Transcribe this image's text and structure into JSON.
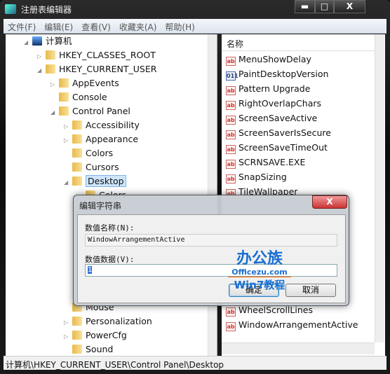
{
  "window": {
    "title": "注册表编辑器",
    "minimize": "▬",
    "maximize": "□",
    "close": "X"
  },
  "menu": [
    "文件(F)",
    "编辑(E)",
    "查看(V)",
    "收藏夹(A)",
    "帮助(H)"
  ],
  "tree": [
    {
      "label": "计算机",
      "level": 0,
      "exp": "◢"
    },
    {
      "label": "HKEY_CLASSES_ROOT",
      "level": 1,
      "exp": "▷"
    },
    {
      "label": "HKEY_CURRENT_USER",
      "level": 1,
      "exp": "◢"
    },
    {
      "label": "AppEvents",
      "level": 2,
      "exp": "▷"
    },
    {
      "label": "Console",
      "level": 2,
      "exp": ""
    },
    {
      "label": "Control Panel",
      "level": 2,
      "exp": "◢"
    },
    {
      "label": "Accessibility",
      "level": 3,
      "exp": "▷"
    },
    {
      "label": "Appearance",
      "level": 3,
      "exp": "▷"
    },
    {
      "label": "Colors",
      "level": 3,
      "exp": ""
    },
    {
      "label": "Cursors",
      "level": 3,
      "exp": ""
    },
    {
      "label": "Desktop",
      "level": 3,
      "exp": "◢",
      "selected": true
    },
    {
      "label": "Colors",
      "level": 4,
      "exp": ""
    },
    {
      "label": "",
      "level": 3,
      "exp": ""
    },
    {
      "label": "",
      "level": 3,
      "exp": ""
    },
    {
      "label": "",
      "level": 3,
      "exp": ""
    },
    {
      "label": "",
      "level": 3,
      "exp": ""
    },
    {
      "label": "",
      "level": 3,
      "exp": ""
    },
    {
      "label": "",
      "level": 3,
      "exp": ""
    },
    {
      "label": "",
      "level": 3,
      "exp": ""
    },
    {
      "label": "Mouse",
      "level": 3,
      "exp": ""
    },
    {
      "label": "Personalization",
      "level": 3,
      "exp": "▷"
    },
    {
      "label": "PowerCfg",
      "level": 3,
      "exp": "▷"
    },
    {
      "label": "Sound",
      "level": 3,
      "exp": ""
    }
  ],
  "list": {
    "header": "名称",
    "items": [
      {
        "name": "MenuShowDelay",
        "type": "ab"
      },
      {
        "name": "PaintDesktopVersion",
        "type": "bin"
      },
      {
        "name": "Pattern Upgrade",
        "type": "ab"
      },
      {
        "name": "RightOverlapChars",
        "type": "ab"
      },
      {
        "name": "ScreenSaveActive",
        "type": "ab"
      },
      {
        "name": "ScreenSaverIsSecure",
        "type": "ab"
      },
      {
        "name": "ScreenSaveTimeOut",
        "type": "ab"
      },
      {
        "name": "SCRNSAVE.EXE",
        "type": "ab"
      },
      {
        "name": "SnapSizing",
        "type": "ab"
      },
      {
        "name": "TileWallpaper",
        "type": "ab"
      }
    ],
    "bottom_items": [
      {
        "name": "WheelScrollLines",
        "type": "ab"
      },
      {
        "name": "WindowArrangementActive",
        "type": "ab"
      }
    ]
  },
  "status": "计算机\\HKEY_CURRENT_USER\\Control Panel\\Desktop",
  "dialog": {
    "title": "编辑字符串",
    "close": "X",
    "name_label": "数值名称(N):",
    "name_value": "WindowArrangementActive",
    "data_label": "数值数据(V):",
    "data_value": "1",
    "ok": "确定",
    "cancel": "取消"
  },
  "watermark": {
    "line1": "办公族",
    "line2": "Officezu.com",
    "line3": "Win7教程"
  }
}
